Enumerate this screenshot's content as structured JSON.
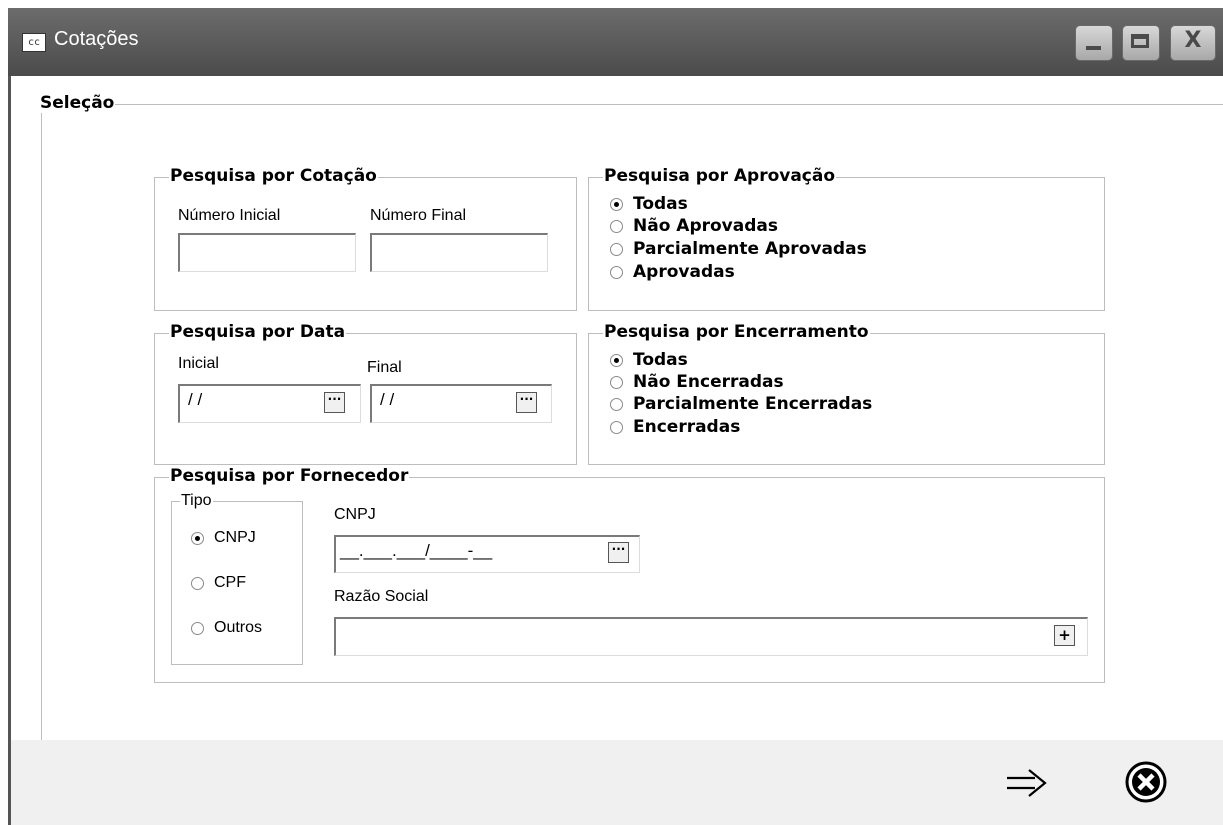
{
  "window": {
    "title": "Cotações",
    "app_icon_text": "cc"
  },
  "selection": {
    "legend": "Seleção",
    "cotacao": {
      "legend": "Pesquisa por Cotação",
      "numero_inicial_label": "Número Inicial",
      "numero_inicial_value": "",
      "numero_final_label": "Número Final",
      "numero_final_value": ""
    },
    "aprovacao": {
      "legend": "Pesquisa por Aprovação",
      "options": [
        "Todas",
        "Não Aprovadas",
        "Parcialmente Aprovadas",
        "Aprovadas"
      ],
      "selected": "Todas"
    },
    "data": {
      "legend": "Pesquisa por Data",
      "inicial_label": "Inicial",
      "inicial_value": "/ /",
      "final_label": "Final",
      "final_value": "/ /",
      "ellipsis": "···"
    },
    "encerramento": {
      "legend": "Pesquisa por Encerramento",
      "options": [
        "Todas",
        "Não Encerradas",
        "Parcialmente Encerradas",
        "Encerradas"
      ],
      "selected": "Todas"
    },
    "fornecedor": {
      "legend": "Pesquisa por Fornecedor",
      "tipo_legend": "Tipo",
      "tipo_options": [
        "CNPJ",
        "CPF",
        "Outros"
      ],
      "tipo_selected": "CNPJ",
      "cnpj_label": "CNPJ",
      "cnpj_value": "__.___.___/____-__",
      "razao_label": "Razão Social",
      "razao_value": "",
      "add_symbol": "+"
    }
  },
  "footer": {
    "next_icon": "arrow-right-icon",
    "cancel_icon": "cancel-circle-icon"
  }
}
